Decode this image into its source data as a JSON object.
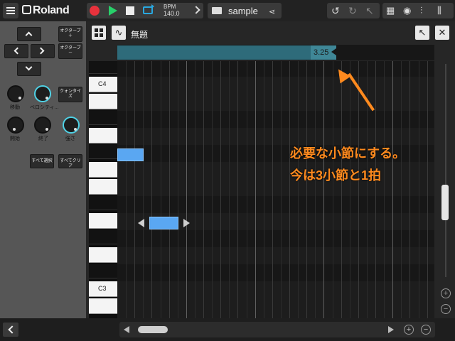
{
  "app": {
    "brand": "Roland",
    "bpm_label": "BPM",
    "bpm_value": "140.0",
    "song_name": "sample",
    "share_glyph": "⋖",
    "undo_glyph": "↺",
    "redo_glyph": "↻",
    "select_glyph": "↖",
    "view_icons": [
      "▦",
      "◉",
      "⫶",
      "⫼"
    ]
  },
  "panel": {
    "octave_up_label": "オクターブ＋",
    "octave_down_label": "オクターブ－",
    "knobs": [
      {
        "label": "移動"
      },
      {
        "label": "ベロシティ..."
      },
      {
        "label": "開始"
      },
      {
        "label": "終了"
      },
      {
        "label": "強さ"
      }
    ],
    "quantize_label": "クォンタイズ",
    "select_all_label": "すべて選択",
    "clear_all_label": "すべてクリア"
  },
  "editor": {
    "pattern_title": "無題",
    "measure_value": "3.25",
    "key_labels": {
      "c4": "C4",
      "c3": "C3"
    },
    "annotation_line1": "必要な小節にする。",
    "annotation_line2": "今は3小節と1拍",
    "zoom_in": "+",
    "zoom_out": "−"
  },
  "colors": {
    "note": "#5aa7f2",
    "region": "#2e6b7a",
    "annotation": "#ff8a1e",
    "rec": "#e8323c",
    "play": "#28d06a",
    "loop": "#29a8e0",
    "knob_active": "#4fd2e6"
  }
}
